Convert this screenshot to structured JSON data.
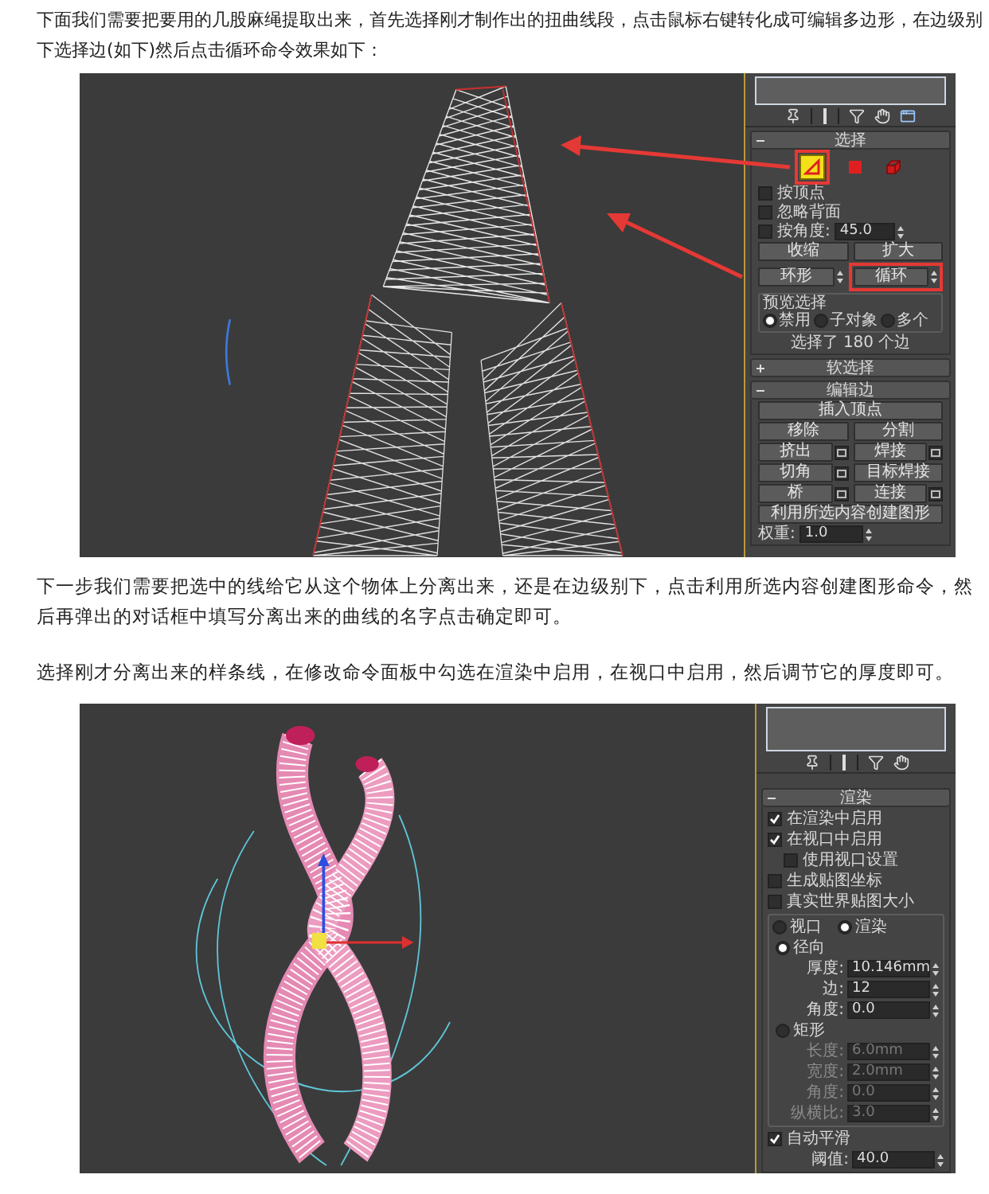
{
  "intro": "下面我们需要把要用的几股麻绳提取出来，首先选择刚才制作出的扭曲线段，点击鼠标右键转化成可编辑多边形，在边级别下选择边(如下)然后点击循环命令效果如下：",
  "screenshot_1": {
    "panel": {
      "selection": {
        "title": "选择",
        "expanded": true,
        "subobjects": [
          {
            "kind": "edge",
            "selected": true,
            "highlighted": true
          },
          {
            "kind": "polygon",
            "selected": false,
            "highlighted": false
          },
          {
            "kind": "element",
            "selected": false,
            "highlighted": false
          }
        ],
        "options": [
          {
            "label": "按顶点",
            "checked": false
          },
          {
            "label": "忽略背面",
            "checked": false
          },
          {
            "label": "按角度:",
            "checked": false,
            "value": "45.0"
          }
        ],
        "buttons": [
          [
            {
              "label": "收缩",
              "spinner": false,
              "highlighted": false
            },
            {
              "label": "扩大",
              "spinner": false,
              "highlighted": false
            }
          ],
          [
            {
              "label": "环形",
              "spinner": true,
              "highlighted": false
            },
            {
              "label": "循环",
              "spinner": true,
              "highlighted": true
            }
          ]
        ],
        "preview": {
          "title": "预览选择",
          "options": [
            {
              "label": "禁用",
              "selected": true
            },
            {
              "label": "子对象",
              "selected": false
            },
            {
              "label": "多个",
              "selected": false
            }
          ]
        },
        "status": "选择了 180 个边"
      },
      "soft_selection": {
        "title": "软选择",
        "expanded": false
      },
      "edit_edges": {
        "title": "编辑边",
        "expanded": true,
        "rows": [
          [
            {
              "label": "插入顶点",
              "settings": false
            }
          ],
          [
            {
              "label": "移除",
              "settings": false
            },
            {
              "label": "分割",
              "settings": false
            }
          ],
          [
            {
              "label": "挤出",
              "settings": true
            },
            {
              "label": "焊接",
              "settings": true
            }
          ],
          [
            {
              "label": "切角",
              "settings": true
            },
            {
              "label": "目标焊接",
              "settings": false
            }
          ],
          [
            {
              "label": "桥",
              "settings": true
            },
            {
              "label": "连接",
              "settings": true
            }
          ],
          [
            {
              "label": "利用所选内容创建图形",
              "settings": false
            }
          ]
        ],
        "weight": {
          "label": "权重:",
          "value": "1.0"
        }
      }
    }
  },
  "paragraph_2": "下一步我们需要把选中的线给它从这个物体上分离出来，还是在边级别下，点击利用所选内容创建图形命令，然后再弹出的对话框中填写分离出来的曲线的名字点击确定即可。",
  "paragraph_3": "选择刚才分离出来的样条线，在修改命令面板中勾选在渲染中启用，在视口中启用，然后调节它的厚度即可。",
  "screenshot_2": {
    "panel": {
      "rendering": {
        "title": "渲染",
        "expanded": true,
        "options": [
          {
            "label": "在渲染中启用",
            "checked": true
          },
          {
            "label": "在视口中启用",
            "checked": true,
            "children": [
              {
                "label": "使用视口设置",
                "checked": false
              }
            ]
          },
          {
            "label": "生成贴图坐标",
            "checked": false
          },
          {
            "label": "真实世界贴图大小",
            "checked": false
          }
        ],
        "mode": [
          {
            "label": "视口",
            "selected": false
          },
          {
            "label": "渲染",
            "selected": true
          }
        ],
        "shapes": [
          {
            "label": "径向",
            "selected": true,
            "fields": [
              {
                "label": "厚度:",
                "value": "10.146mm"
              },
              {
                "label": "边:",
                "value": "12"
              },
              {
                "label": "角度:",
                "value": "0.0"
              }
            ]
          },
          {
            "label": "矩形",
            "selected": false,
            "fields": [
              {
                "label": "长度:",
                "value": "6.0mm"
              },
              {
                "label": "宽度:",
                "value": "2.0mm"
              },
              {
                "label": "角度:",
                "value": "0.0"
              },
              {
                "label": "纵横比:",
                "value": "3.0"
              }
            ]
          }
        ],
        "auto_smooth": {
          "label": "自动平滑",
          "checked": true
        },
        "threshold": {
          "label": "阈值:",
          "value": "40.0"
        }
      }
    }
  }
}
